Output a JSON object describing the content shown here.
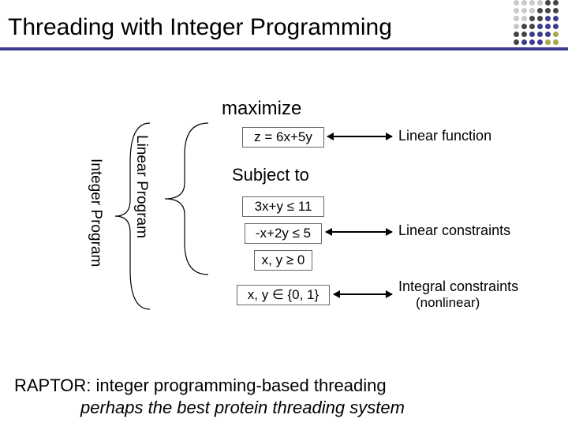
{
  "title": "Threading with Integer Programming",
  "labels": {
    "linear_program": "Linear Program",
    "integer_program": "Integer Program",
    "maximize": "maximize",
    "subject_to": "Subject to"
  },
  "equations": {
    "objective": "z = 6x+5y",
    "c1": "3x+y ≤ 11",
    "c2": "-x+2y ≤ 5",
    "c3": "x, y ≥ 0",
    "integrality": "x, y ∈ {0, 1}"
  },
  "annotations": {
    "objective": "Linear function",
    "constraints": "Linear constraints",
    "integrality_line1": "Integral constraints",
    "integrality_line2": "(nonlinear)"
  },
  "footer": {
    "raptor": "RAPTOR:",
    "line1_rest": " integer programming-based threading",
    "line2": "perhaps the best protein threading system"
  }
}
